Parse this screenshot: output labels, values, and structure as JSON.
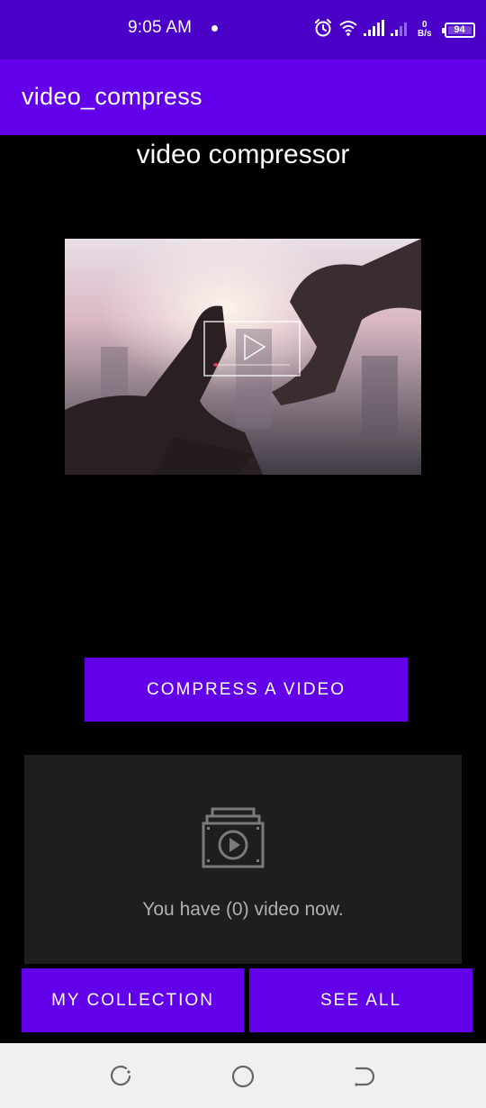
{
  "status_bar": {
    "time": "9:05 AM",
    "net_speed_value": "0",
    "net_speed_unit": "B/s",
    "battery": "94"
  },
  "app_bar": {
    "title": "video_compress"
  },
  "main": {
    "heading": "video compressor",
    "compress_button": "COMPRESS A VIDEO",
    "empty_state_text": "You have (0) video now.",
    "collection_button": "MY COLLECTION",
    "see_all_button": "SEE ALL"
  },
  "colors": {
    "status_bar": "#4b00c8",
    "primary": "#6200ea",
    "background": "#000000",
    "card": "#1e1e1e"
  },
  "icons": [
    "alarm-icon",
    "wifi-icon",
    "signal-icon",
    "signal-icon-2",
    "battery-icon",
    "video-collection-icon",
    "back-icon",
    "home-icon",
    "recents-icon"
  ]
}
